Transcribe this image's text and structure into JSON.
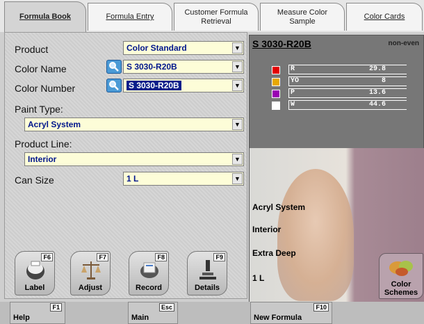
{
  "tabs": [
    {
      "label": "Formula Book",
      "active": true
    },
    {
      "label": "Formula Entry",
      "active": false
    },
    {
      "label": "Customer Formula\nRetrieval",
      "active": false
    },
    {
      "label": "Measure Color\nSample",
      "active": false
    },
    {
      "label": "Color Cards",
      "active": false
    }
  ],
  "form": {
    "product_label": "Product",
    "product_value": "Color Standard",
    "color_name_label": "Color Name",
    "color_name_value": "S 3030-R20B",
    "color_number_label": "Color Number",
    "color_number_value": "S 3030-R20B",
    "paint_type_label": "Paint Type:",
    "paint_type_value": "Acryl System",
    "product_line_label": "Product Line:",
    "product_line_value": "Interior",
    "can_size_label": "Can Size",
    "can_size_value": "1 L"
  },
  "function_buttons": [
    {
      "key": "F6",
      "label": "Label",
      "icon": "printer-icon"
    },
    {
      "key": "F7",
      "label": "Adjust",
      "icon": "scale-icon"
    },
    {
      "key": "F8",
      "label": "Record",
      "icon": "rolodex-icon"
    },
    {
      "key": "F9",
      "label": "Details",
      "icon": "microscope-icon"
    }
  ],
  "color_panel": {
    "title": "S 3030-R20B",
    "flag": "non-even",
    "rows": [
      {
        "key": "R",
        "value": "29.8",
        "color": "#e30000"
      },
      {
        "key": "YO",
        "value": "8",
        "color": "#e8a800"
      },
      {
        "key": "P",
        "value": "13.6",
        "color": "#9900b3"
      },
      {
        "key": "W",
        "value": "44.6",
        "color": "#ffffff"
      }
    ]
  },
  "photo_info": {
    "paint_type": "Acryl System",
    "product_line": "Interior",
    "base": "Extra Deep",
    "can_size": "1 L"
  },
  "color_schemes_label": "Color\nSchemes",
  "bottom_buttons": [
    {
      "key": "F1",
      "label": "Help"
    },
    {
      "key": "Esc",
      "label": "Main"
    },
    {
      "key": "F10",
      "label": "New Formula"
    }
  ]
}
